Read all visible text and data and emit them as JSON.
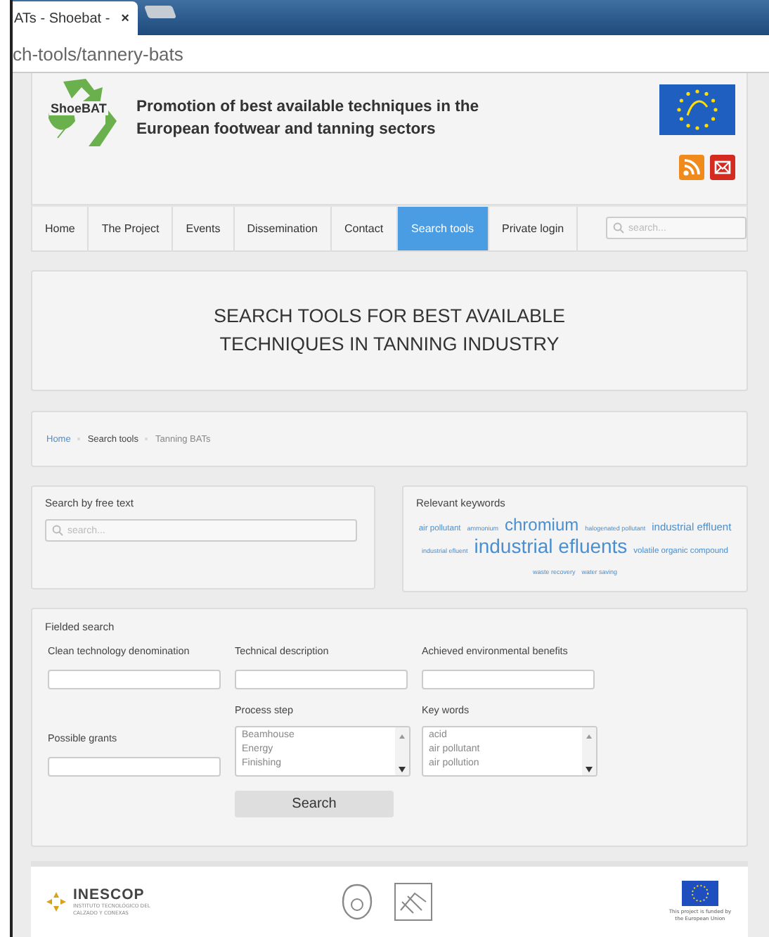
{
  "browser": {
    "tab_title": "ATs - Shoebat -",
    "tab_close": "×",
    "address": "ch-tools/tannery-bats"
  },
  "header": {
    "logo_text": "ShoeBAT",
    "title": "Promotion of best available techniques in the European footwear and tanning sectors"
  },
  "nav": {
    "items": [
      {
        "label": "Home",
        "selected": false
      },
      {
        "label": "The Project",
        "selected": false
      },
      {
        "label": "Events",
        "selected": false
      },
      {
        "label": "Dissemination",
        "selected": false
      },
      {
        "label": "Contact",
        "selected": false
      },
      {
        "label": "Search tools",
        "selected": true
      },
      {
        "label": "Private login",
        "selected": false
      }
    ],
    "search_placeholder": "search..."
  },
  "page_title": "SEARCH TOOLS FOR BEST AVAILABLE TECHNIQUES IN TANNING INDUSTRY",
  "breadcrumb": [
    {
      "label": "Home",
      "kind": "link"
    },
    {
      "label": "Search tools",
      "kind": "text"
    },
    {
      "label": "Tanning BATs",
      "kind": "current"
    }
  ],
  "free_text": {
    "title": "Search by free text",
    "placeholder": "search..."
  },
  "keywords": {
    "title": "Relevant keywords",
    "tags": [
      {
        "label": "air pollutant",
        "kind": "small"
      },
      {
        "label": "ammonium",
        "kind": "tiny"
      },
      {
        "label": "chromium",
        "kind": "large"
      },
      {
        "label": "halogenated pollutant",
        "kind": "tiny"
      },
      {
        "label": "industrial effluent",
        "kind": "medium"
      },
      {
        "label": "industrial efluent",
        "kind": "tiny"
      },
      {
        "label": "industrial efluents",
        "kind": "huge"
      },
      {
        "label": "volatile organic compound",
        "kind": "small"
      },
      {
        "label": "waste recovery",
        "kind": "tiny"
      },
      {
        "label": "water saving",
        "kind": "tiny"
      }
    ]
  },
  "fielded_search": {
    "title": "Fielded search",
    "fields": [
      {
        "label": "Clean technology denomination",
        "kind": "text"
      },
      {
        "label": "Technical description",
        "kind": "text"
      },
      {
        "label": "Achieved environmental benefits",
        "kind": "text"
      },
      {
        "label": "Possible grants",
        "kind": "text"
      },
      {
        "label": "Process step",
        "kind": "list",
        "options": [
          "Beamhouse",
          "Energy",
          "Finishing"
        ]
      },
      {
        "label": "Key words",
        "kind": "list",
        "options": [
          "acid",
          "air pollutant",
          "air pollution"
        ]
      }
    ],
    "button": "Search"
  },
  "footer": {
    "org_name": "INESCOP",
    "org_subtitle": "INSTITUTO TECNOLÓGICO DEL CALZADO Y CONEXAS",
    "funding_note": "This project is funded by the European Union"
  }
}
